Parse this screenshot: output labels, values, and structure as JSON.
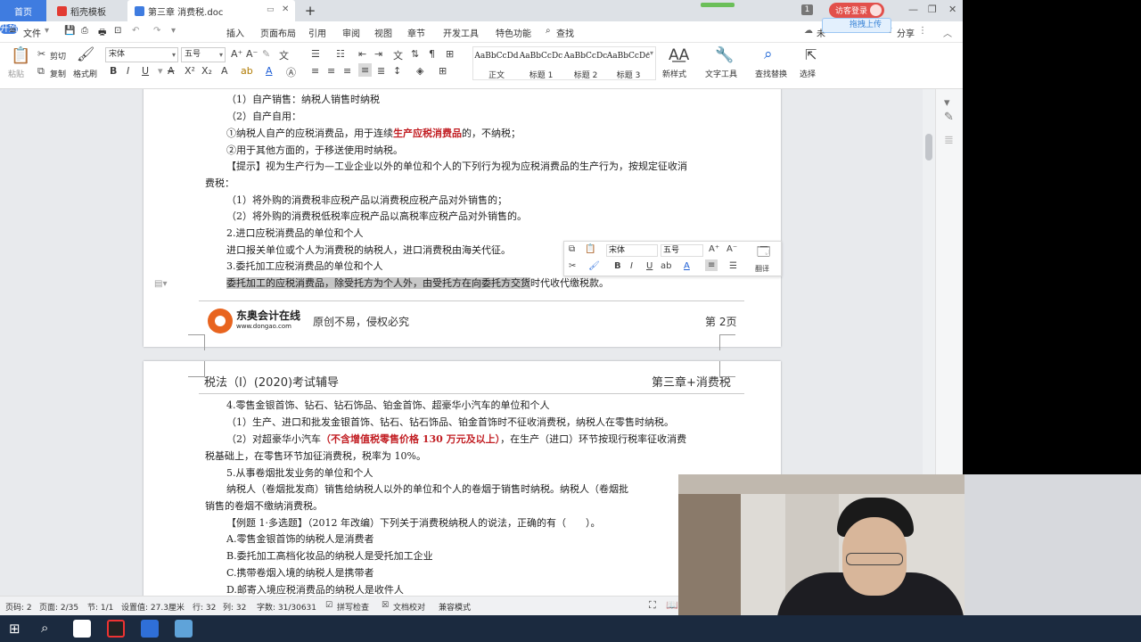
{
  "tabs": {
    "home": "首页",
    "template": "稻壳模板",
    "doc": "第三章 消费税.doc"
  },
  "header_right": {
    "login": "访客登录",
    "badge": "1",
    "upload": "拖拽上传",
    "collab": "未",
    "share": "分享"
  },
  "menu": {
    "file": "文件",
    "start": "开始",
    "insert": "插入",
    "layout": "页面布局",
    "ref": "引用",
    "review": "审阅",
    "view": "视图",
    "chapter": "章节",
    "dev": "开发工具",
    "special": "特色功能",
    "search": "查找"
  },
  "ribbon": {
    "paste": "粘贴",
    "cut": "剪切",
    "copy": "复制",
    "format_painter": "格式刷",
    "font": "宋体",
    "size": "五号",
    "styles": [
      {
        "preview": "AaBbCcDd",
        "name": "正文"
      },
      {
        "preview": "AaBbCcDc",
        "name": "标题 1"
      },
      {
        "preview": "AaBbCcDc",
        "name": "标题 2"
      },
      {
        "preview": "AaBbCcDc",
        "name": "标题 3"
      }
    ],
    "new_style": "新样式",
    "text_tools": "文字工具",
    "find_replace": "查找替换",
    "select": "选择"
  },
  "page1": {
    "lines": [
      "（1）自产销售：纳税人销售时纳税",
      "（2）自产自用：",
      "①纳税人自产的应税消费品，用于连续",
      "②用于其他方面的，于移送使用时纳税。",
      "【提示】视为生产行为—工业企业以外的单位和个人的下列行为视为应税消费品的生产行为，按规定征收消",
      "费税：",
      "（1）将外购的消费税非应税产品以消费税应税产品对外销售的；",
      "（2）将外购的消费税低税率应税产品以高税率应税产品对外销售的。",
      "2.进口应税消费品的单位和个人",
      "进口报关单位或个人为消费税的纳税人，进口消费税由海关代征。",
      "3.委托加工应税消费品的单位和个人"
    ],
    "line3_red": "生产应税消费品",
    "line3_tail": "的，不纳税；",
    "last_selected": "委托加工的应税消费品，除受托方为个人外，由受托方在向委托方交货",
    "last_tail": "时代收代缴税款。",
    "footer_logo": "东奥会计在线",
    "footer_url": "www.dongao.com",
    "footer_slogan": "原创不易，侵权必究",
    "footer_page": "第 2页"
  },
  "float_toolbar": {
    "font": "宋体",
    "size": "五号",
    "translate": "翻译"
  },
  "page2": {
    "header_left": "税法（Ⅰ）(2020)考试辅导",
    "header_right": "第三章+消费税",
    "l1": "4.零售金银首饰、钻石、钻石饰品、铂金首饰、超豪华小汽车的单位和个人",
    "l2": "（1）生产、进口和批发金银首饰、钻石、钻石饰品、铂金首饰时不征收消费税，纳税人在零售时纳税。",
    "l3a": "（2）对超豪华小汽车",
    "l3red": "（不含增值税零售价格 130 万元及以上）",
    "l3b": "，在生产（进口）环节按现行税率征收消费",
    "l4": "税基础上，在零售环节加征消费税，税率为 10%。",
    "l5": "5.从事卷烟批发业务的单位和个人",
    "l6": "纳税人（卷烟批发商）销售给纳税人以外的单位和个人的卷烟于销售时纳税。纳税人（卷烟批",
    "l7": "销售的卷烟不缴纳消费税。",
    "l8": "【例题 1·多选题】（2012 年改编）下列关于消费税纳税人的说法，正确的有（　　）。",
    "opts": [
      "A.零售金银首饰的纳税人是消费者",
      "B.委托加工高档化妆品的纳税人是受托加工企业",
      "C.携带卷烟入境的纳税人是携带者",
      "D.邮寄入境应税消费品的纳税人是收件人"
    ]
  },
  "status": {
    "page_no": "页码: 2",
    "pages": "页面: 2/35",
    "section": "节: 1/1",
    "setting": "设置值: 27.3厘米",
    "row": "行: 32",
    "col": "列: 32",
    "words": "字数: 31/30631",
    "spell": "拼写检查",
    "proof": "文档校对",
    "compat": "兼容模式"
  }
}
